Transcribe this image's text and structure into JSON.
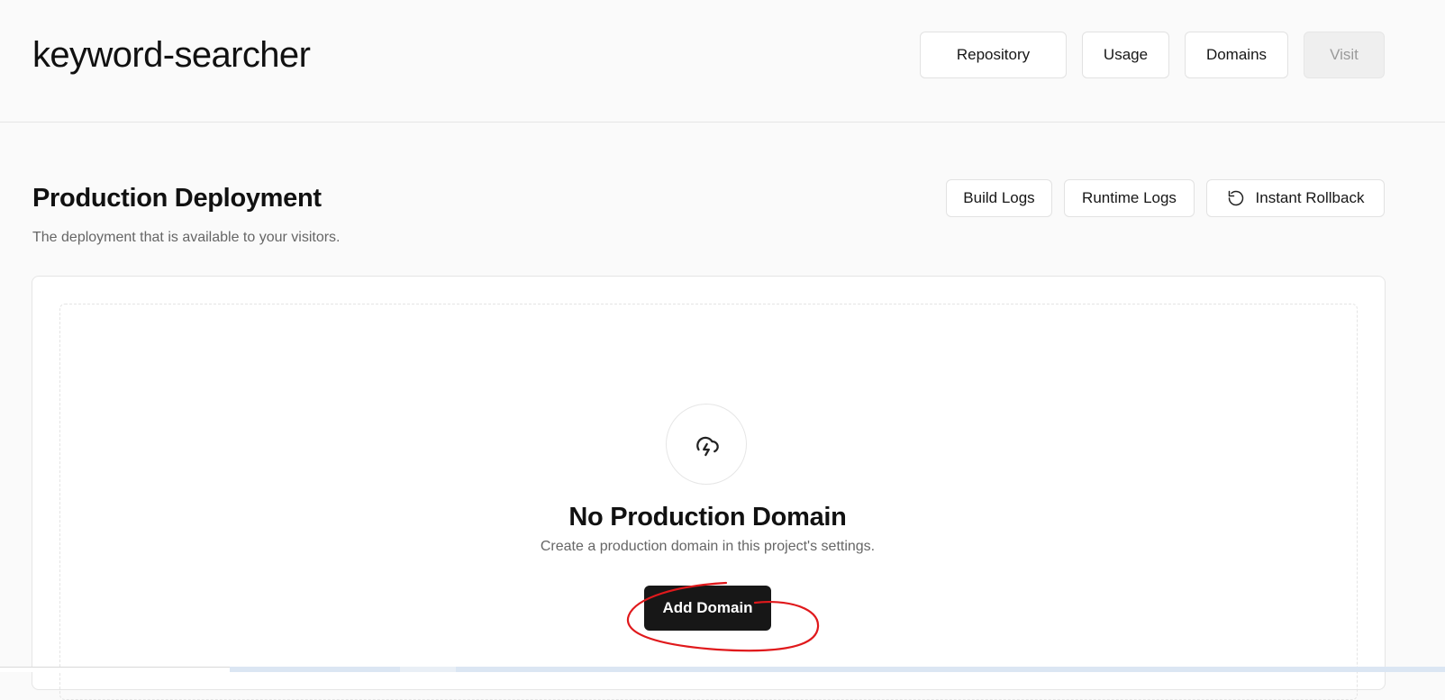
{
  "header": {
    "project_name": "keyword-searcher",
    "buttons": {
      "repository": "Repository",
      "usage": "Usage",
      "domains": "Domains",
      "visit": "Visit"
    }
  },
  "production": {
    "title": "Production Deployment",
    "subtitle": "The deployment that is available to your visitors.",
    "buttons": {
      "build_logs": "Build Logs",
      "runtime_logs": "Runtime Logs",
      "instant_rollback": "Instant Rollback"
    }
  },
  "empty_state": {
    "icon": "cloud-lightning-icon",
    "title": "No Production Domain",
    "description": "Create a production domain in this project's settings.",
    "action_label": "Add Domain"
  },
  "colors": {
    "primary_button_bg": "#171717",
    "annotation_circle": "#e0191c",
    "page_bg": "#fafafa"
  }
}
